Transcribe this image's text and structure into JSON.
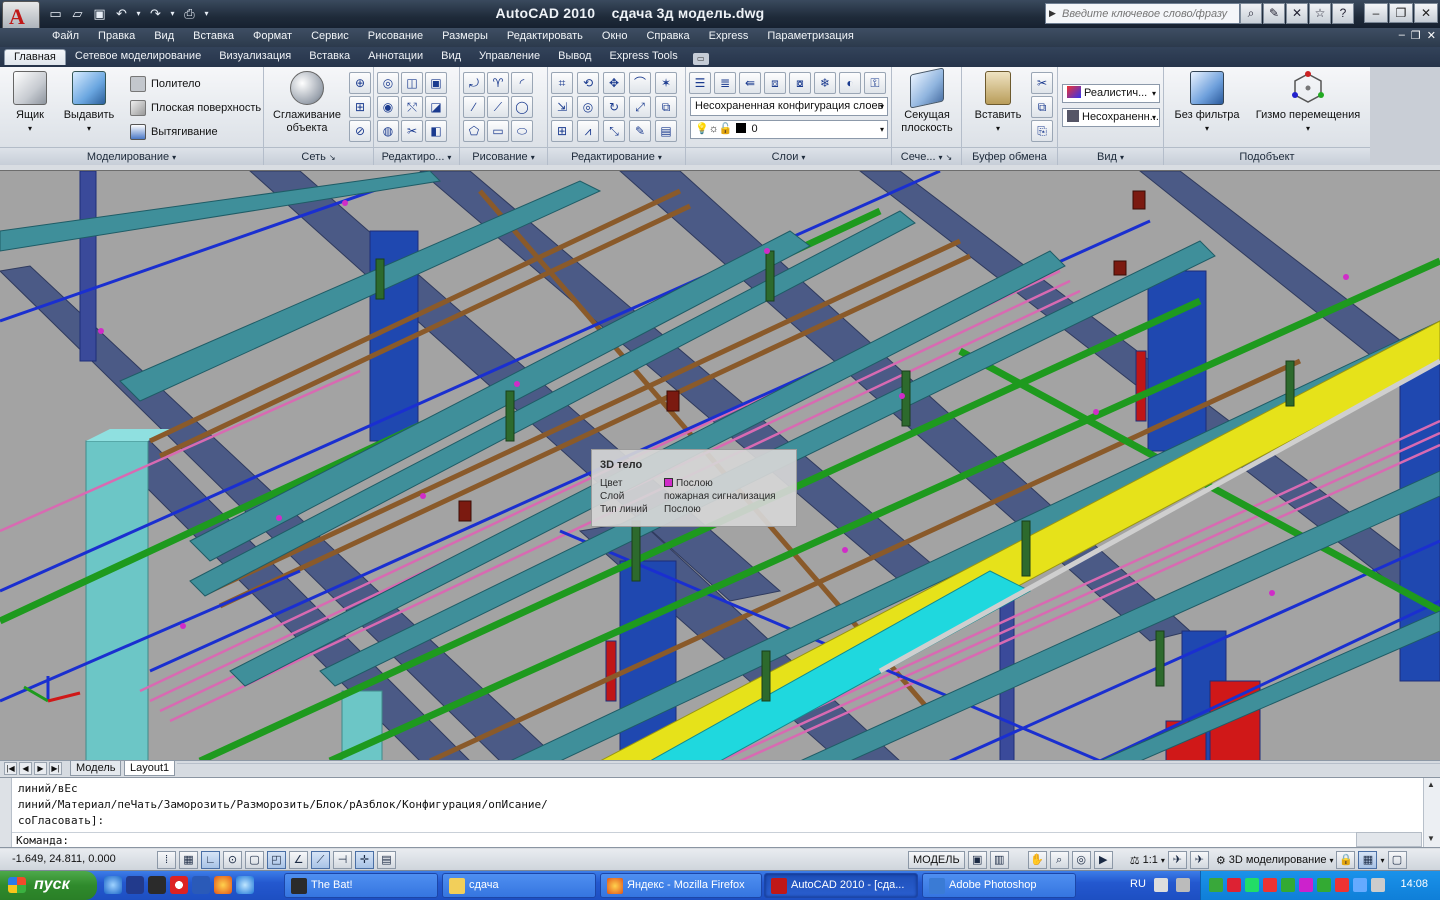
{
  "titlebar": {
    "app_title": "AutoCAD 2010",
    "doc_title": "сдача 3д модель.dwg",
    "search_placeholder": "Введите ключевое слово/фразу"
  },
  "menu": [
    "Файл",
    "Правка",
    "Вид",
    "Вставка",
    "Формат",
    "Сервис",
    "Рисование",
    "Размеры",
    "Редактировать",
    "Окно",
    "Справка",
    "Express",
    "Параметризация"
  ],
  "ribbon_tabs": [
    "Главная",
    "Сетевое моделирование",
    "Визуализация",
    "Вставка",
    "Аннотации",
    "Вид",
    "Управление",
    "Вывод",
    "Express Tools"
  ],
  "ribbon": {
    "modeling": {
      "title": "Моделирование",
      "box": "Ящик",
      "extrude": "Выдавить",
      "polysolid": "Политело",
      "planar": "Плоская поверхность",
      "presspull": "Вытягивание"
    },
    "mesh": {
      "title": "Сеть",
      "smooth_line1": "Сглаживание",
      "smooth_line2": "объекта"
    },
    "solid_edit": {
      "title": "Редактиро..."
    },
    "draw": {
      "title": "Рисование"
    },
    "modify": {
      "title": "Редактирование"
    },
    "layers": {
      "title": "Слои",
      "state_combo": "Несохраненная конфигурация слоев",
      "layer_combo": "0"
    },
    "section": {
      "title": "Сече...",
      "plane_line1": "Секущая",
      "plane_line2": "плоскость"
    },
    "clipboard": {
      "title": "Буфер обмена",
      "paste": "Вставить"
    },
    "view": {
      "title": "Вид",
      "visual_style": "Реалистич...",
      "view_state": "Несохраненн..."
    },
    "subobject": {
      "title": "Подобъект",
      "no_filter": "Без фильтра",
      "gizmo": "Гизмо перемещения"
    }
  },
  "tooltip": {
    "title": "3D тело",
    "rows": [
      {
        "label": "Цвет",
        "value": "Послою"
      },
      {
        "label": "Слой",
        "value": "пожарная сигнализация"
      },
      {
        "label": "Тип линий",
        "value": "Послою"
      }
    ],
    "swatch_color": "#d02cc8"
  },
  "layout_tabs": [
    "Модель",
    "Layout1"
  ],
  "command": {
    "lines": [
      "линий/вЕс",
      "линий/Материал/пеЧать/Заморозить/Разморозить/Блок/рАзблок/Конфигурация/опИсание/",
      "соГласовать]:"
    ],
    "prompt": "Команда:"
  },
  "status": {
    "coords": "-1.649, 24.811, 0.000",
    "model_label": "МОДЕЛЬ",
    "scale": "1:1",
    "workspace": "3D моделирование"
  },
  "taskbar": {
    "start": "пуск",
    "tasks": [
      "The Bat!",
      "сдача",
      "Яндекс - Mozilla Firefox",
      "AutoCAD 2010 - [сда...",
      "Adobe Photoshop"
    ],
    "lang": "RU",
    "clock": "14:08"
  },
  "colors": {
    "viewport_bg": "#a3a3a3",
    "steel": "#4b5a86",
    "pipe_green": "#1e9a1e",
    "pipe_blue": "#1a2fd0",
    "pipe_brown": "#8a5a2a",
    "pipe_pink": "#d86ab2",
    "tray_yellow": "#e6e21a",
    "duct_cyan": "#1fd8de",
    "beam_teal": "#3f8f9a"
  }
}
